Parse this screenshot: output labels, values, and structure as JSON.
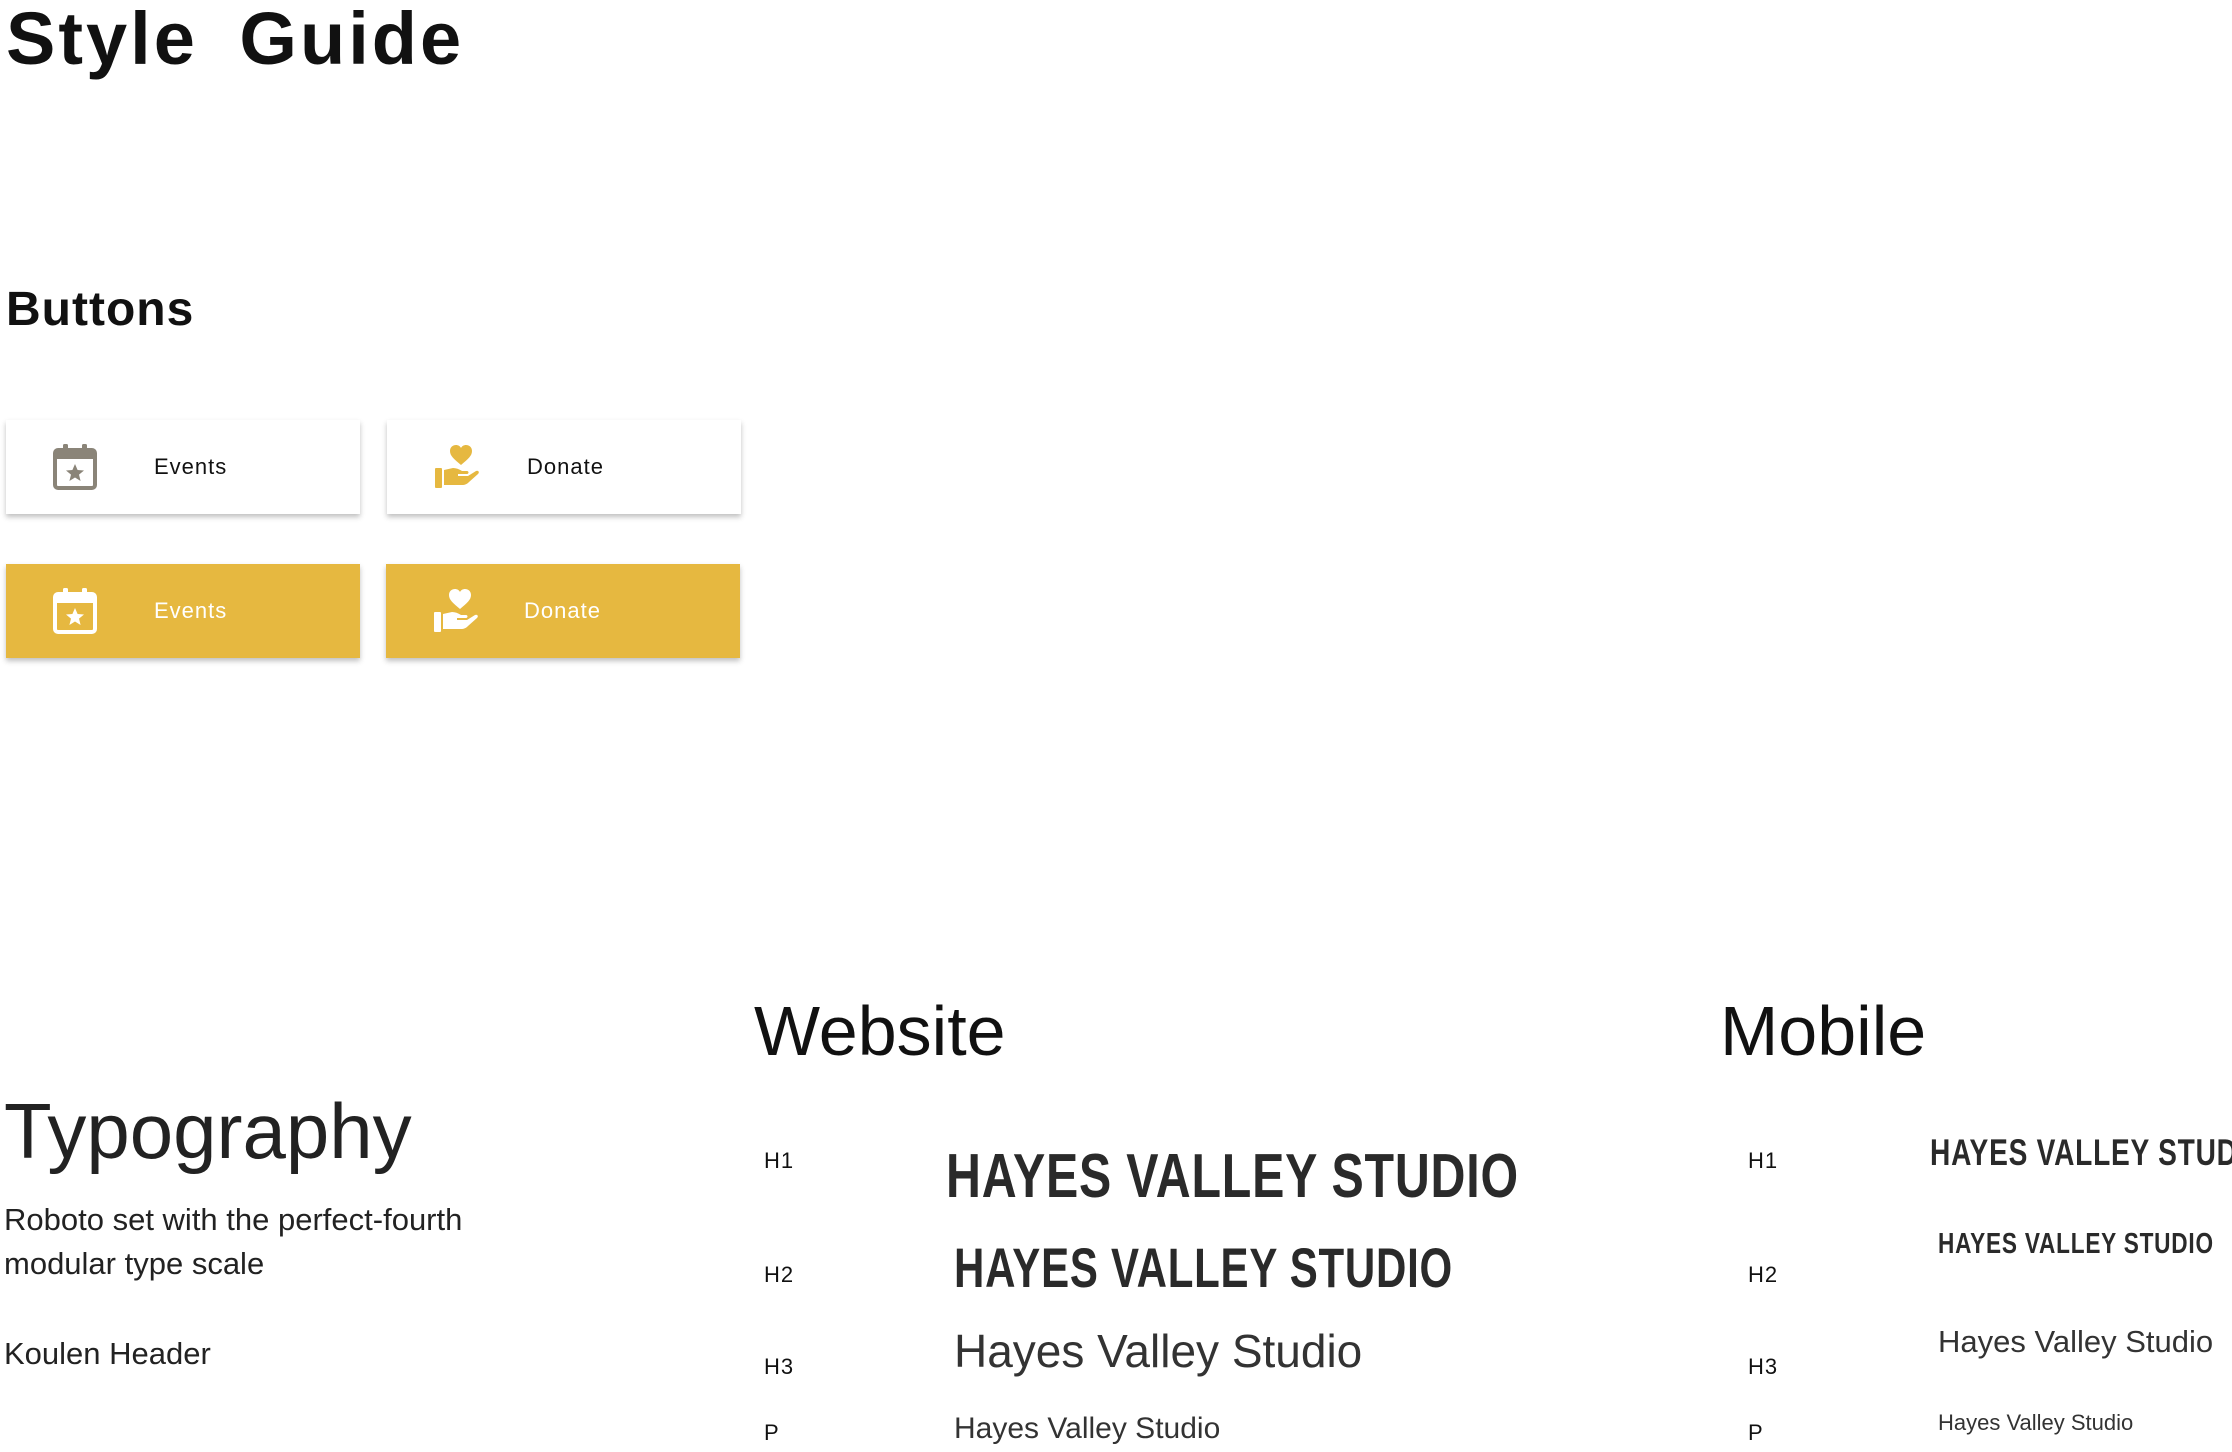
{
  "page": {
    "title": "Style Guide"
  },
  "buttons": {
    "title": "Buttons",
    "items": [
      {
        "label": "Events",
        "icon": "calendar-star-icon",
        "style": "outline"
      },
      {
        "label": "Donate",
        "icon": "heart-hand-icon",
        "style": "outline"
      },
      {
        "label": "Events",
        "icon": "calendar-star-icon",
        "style": "filled"
      },
      {
        "label": "Donate",
        "icon": "heart-hand-icon",
        "style": "filled"
      }
    ]
  },
  "colors": {
    "accent": "#e6b840",
    "calendar_icon_outline": "#8a8478",
    "text_dark": "#111111"
  },
  "typography": {
    "title": "Typography",
    "description": "Roboto set with the perfect-fourth modular type scale",
    "header_font": "Koulen Header",
    "website": {
      "title": "Website",
      "h1_tag": "H1",
      "h2_tag": "H2",
      "h3_tag": "H3",
      "p_tag": "P",
      "h1_sample": "HAYES VALLEY STUDIO",
      "h2_sample": "HAYES VALLEY STUDIO",
      "h3_sample": "Hayes Valley Studio",
      "p_sample": "Hayes Valley Studio"
    },
    "mobile": {
      "title": "Mobile",
      "h1_tag": "H1",
      "h2_tag": "H2",
      "h3_tag": "H3",
      "p_tag": "P",
      "h1_sample": "HAYES VALLEY STUDIO",
      "h2_sample": "HAYES VALLEY STUDIO",
      "h3_sample": "Hayes Valley Studio",
      "p_sample": "Hayes Valley Studio"
    }
  }
}
